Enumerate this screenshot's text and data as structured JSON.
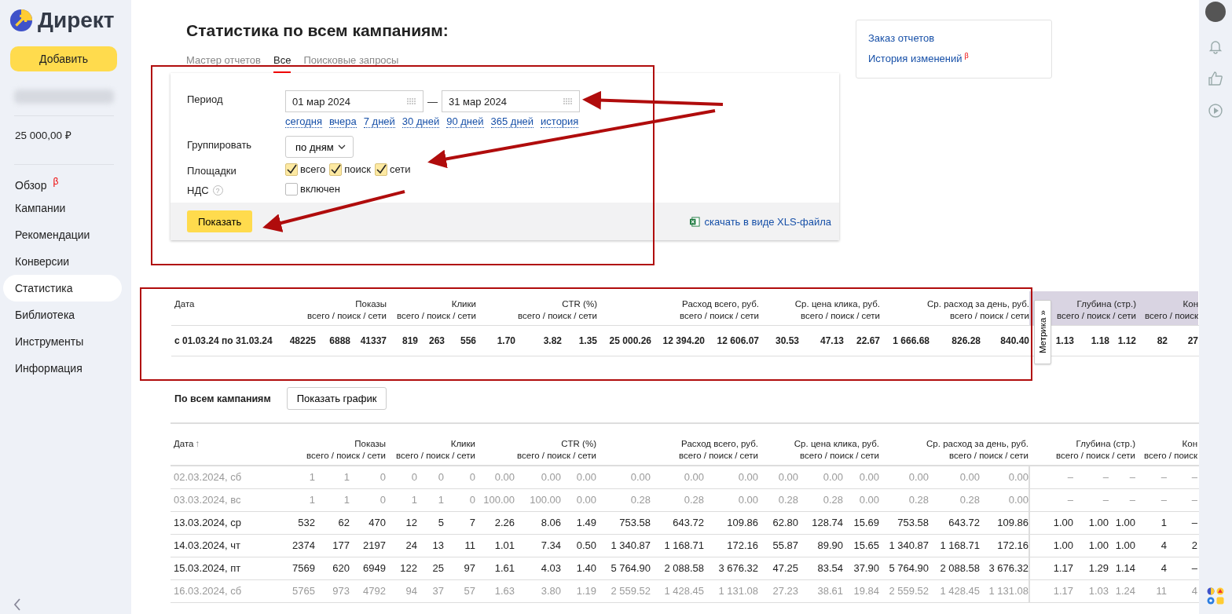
{
  "logo": {
    "text": "Директ"
  },
  "sidebar": {
    "add_button": "Добавить",
    "balance": "25 000,00 ₽",
    "items": [
      {
        "label": "Обзор",
        "badge": "β",
        "selected": false
      },
      {
        "label": "Кампании",
        "selected": false
      },
      {
        "label": "Рекомендации",
        "selected": false
      },
      {
        "label": "Конверсии",
        "selected": false
      },
      {
        "label": "Статистика",
        "selected": true
      },
      {
        "label": "Библиотека",
        "selected": false
      },
      {
        "label": "Инструменты",
        "selected": false
      },
      {
        "label": "Информация",
        "selected": false
      }
    ]
  },
  "page": {
    "title": "Статистика по всем кампаниям:"
  },
  "tabs": [
    {
      "label": "Мастер отчетов",
      "selected": false
    },
    {
      "label": "Все",
      "selected": true
    },
    {
      "label": "Поисковые запросы",
      "selected": false
    }
  ],
  "side_links": [
    {
      "label": "Заказ отчетов"
    },
    {
      "label": "История изменений",
      "badge": "β"
    }
  ],
  "form": {
    "period": {
      "label": "Период",
      "from": "01 мар 2024",
      "dash": "—",
      "to": "31 мар 2024",
      "presets": [
        "сегодня",
        "вчера",
        "7 дней",
        "30 дней",
        "90 дней",
        "365 дней",
        "история"
      ]
    },
    "grouping": {
      "label": "Группировать",
      "value": "по дням"
    },
    "platforms": {
      "label": "Площадки",
      "options": [
        {
          "label": "всего",
          "checked": true
        },
        {
          "label": "поиск",
          "checked": true
        },
        {
          "label": "сети",
          "checked": true
        }
      ]
    },
    "vat": {
      "label": "НДС",
      "help": "?",
      "options": [
        {
          "label": "включен",
          "checked": false
        }
      ]
    },
    "show_button": "Показать",
    "xls_link": "скачать в виде XLS-файла"
  },
  "summary": {
    "date_header": "Дата",
    "metrika_tab": "Метрика »",
    "columns": [
      {
        "name": "Показы",
        "sub": "всего / поиск / сети",
        "metrika": false
      },
      {
        "name": "Клики",
        "sub": "всего / поиск / сети",
        "metrika": false
      },
      {
        "name": "CTR (%)",
        "sub": "всего / поиск / сети",
        "metrika": false
      },
      {
        "name": "Расход всего, руб.",
        "sub": "всего / поиск / сети",
        "metrika": false
      },
      {
        "name": "Ср. цена клика, руб.",
        "sub": "всего / поиск / сети",
        "metrika": false
      },
      {
        "name": "Ср. расход за день, руб.",
        "sub": "всего / поиск / сети",
        "metrika": false
      },
      {
        "name": "Глубина (стр.)",
        "sub": "всего / поиск / сети",
        "metrika": true
      },
      {
        "name": "Кон",
        "sub": "всего / поиск",
        "metrika": true
      }
    ],
    "row": {
      "date": "с 01.03.24 по 31.03.24",
      "values": [
        [
          "48225",
          "6888",
          "41337"
        ],
        [
          "819",
          "263",
          "556"
        ],
        [
          "1.70",
          "3.82",
          "1.35"
        ],
        [
          "25 000.26",
          "12 394.20",
          "12 606.07"
        ],
        [
          "30.53",
          "47.13",
          "22.67"
        ],
        [
          "1 666.68",
          "826.28",
          "840.40"
        ],
        [
          "1.13",
          "1.18",
          "1.12"
        ],
        [
          "82",
          "27"
        ]
      ]
    }
  },
  "campaigns": {
    "title": "По всем кампаниям",
    "chart_button": "Показать график",
    "date_header": "Дата",
    "sort_mark": "↑",
    "columns": [
      {
        "name": "Показы",
        "sub": "всего / поиск / сети"
      },
      {
        "name": "Клики",
        "sub": "всего / поиск / сети"
      },
      {
        "name": "CTR (%)",
        "sub": "всего / поиск / сети"
      },
      {
        "name": "Расход всего, руб.",
        "sub": "всего / поиск / сети"
      },
      {
        "name": "Ср. цена клика, руб.",
        "sub": "всего / поиск / сети"
      },
      {
        "name": "Ср. расход за день, руб.",
        "sub": "всего / поиск / сети"
      },
      {
        "name": "Глубина (стр.)",
        "sub": "всего / поиск / сети"
      },
      {
        "name": "Кон",
        "sub": "всего / поиск"
      }
    ],
    "rows": [
      {
        "date": "02.03.2024, сб",
        "muted": true,
        "values": [
          [
            "1",
            "1",
            "0"
          ],
          [
            "0",
            "0",
            "0"
          ],
          [
            "0.00",
            "0.00",
            "0.00"
          ],
          [
            "0.00",
            "0.00",
            "0.00"
          ],
          [
            "0.00",
            "0.00",
            "0.00"
          ],
          [
            "0.00",
            "0.00",
            "0.00"
          ],
          [
            "–",
            "–",
            "–"
          ],
          [
            "–",
            "–"
          ]
        ]
      },
      {
        "date": "03.03.2024, вс",
        "muted": true,
        "values": [
          [
            "1",
            "1",
            "0"
          ],
          [
            "1",
            "1",
            "0"
          ],
          [
            "100.00",
            "100.00",
            "0.00"
          ],
          [
            "0.28",
            "0.28",
            "0.00"
          ],
          [
            "0.28",
            "0.28",
            "0.00"
          ],
          [
            "0.28",
            "0.28",
            "0.00"
          ],
          [
            "–",
            "–",
            "–"
          ],
          [
            "–",
            "–"
          ]
        ]
      },
      {
        "date": "13.03.2024, ср",
        "muted": false,
        "values": [
          [
            "532",
            "62",
            "470"
          ],
          [
            "12",
            "5",
            "7"
          ],
          [
            "2.26",
            "8.06",
            "1.49"
          ],
          [
            "753.58",
            "643.72",
            "109.86"
          ],
          [
            "62.80",
            "128.74",
            "15.69"
          ],
          [
            "753.58",
            "643.72",
            "109.86"
          ],
          [
            "1.00",
            "1.00",
            "1.00"
          ],
          [
            "1",
            "–"
          ]
        ]
      },
      {
        "date": "14.03.2024, чт",
        "muted": false,
        "values": [
          [
            "2374",
            "177",
            "2197"
          ],
          [
            "24",
            "13",
            "11"
          ],
          [
            "1.01",
            "7.34",
            "0.50"
          ],
          [
            "1 340.87",
            "1 168.71",
            "172.16"
          ],
          [
            "55.87",
            "89.90",
            "15.65"
          ],
          [
            "1 340.87",
            "1 168.71",
            "172.16"
          ],
          [
            "1.00",
            "1.00",
            "1.00"
          ],
          [
            "4",
            "2"
          ]
        ]
      },
      {
        "date": "15.03.2024, пт",
        "muted": false,
        "values": [
          [
            "7569",
            "620",
            "6949"
          ],
          [
            "122",
            "25",
            "97"
          ],
          [
            "1.61",
            "4.03",
            "1.40"
          ],
          [
            "5 764.90",
            "2 088.58",
            "3 676.32"
          ],
          [
            "47.25",
            "83.54",
            "37.90"
          ],
          [
            "5 764.90",
            "2 088.58",
            "3 676.32"
          ],
          [
            "1.17",
            "1.29",
            "1.14"
          ],
          [
            "4",
            "–"
          ]
        ]
      },
      {
        "date": "16.03.2024, сб",
        "muted": true,
        "values": [
          [
            "5765",
            "973",
            "4792"
          ],
          [
            "94",
            "37",
            "57"
          ],
          [
            "1.63",
            "3.80",
            "1.19"
          ],
          [
            "2 559.52",
            "1 428.45",
            "1 131.08"
          ],
          [
            "27.23",
            "38.61",
            "19.84"
          ],
          [
            "2 559.52",
            "1 428.45",
            "1 131.08"
          ],
          [
            "1.17",
            "1.03",
            "1.24"
          ],
          [
            "11",
            "4"
          ]
        ]
      }
    ]
  }
}
